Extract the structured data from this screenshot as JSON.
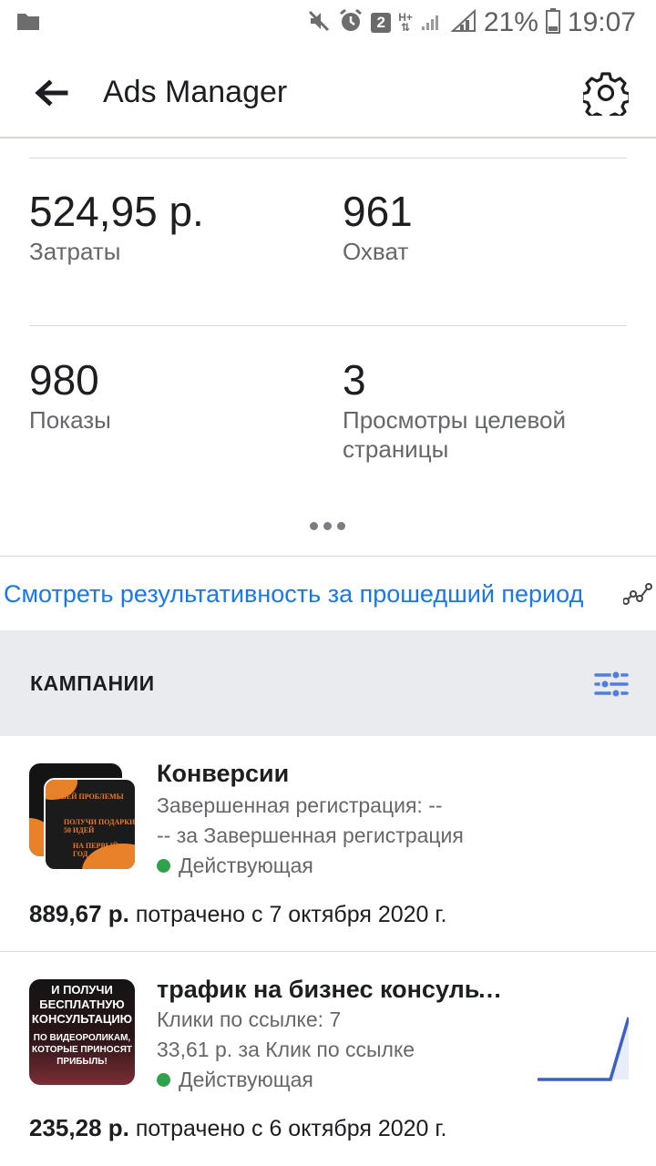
{
  "status_bar": {
    "battery": "21%",
    "time": "19:07",
    "sim_badge": "2",
    "network": "H+"
  },
  "app_bar": {
    "title": "Ads Manager"
  },
  "metrics": [
    {
      "value": "524,95 р.",
      "label": "Затраты"
    },
    {
      "value": "961",
      "label": "Охват"
    },
    {
      "value": "980",
      "label": "Показы"
    },
    {
      "value": "3",
      "label": "Просмотры целевой страницы"
    }
  ],
  "performance_link": "Смотреть результативность за прошедший период",
  "campaigns_section": {
    "title": "КАМПАНИИ"
  },
  "campaigns": [
    {
      "name": "Конверсии",
      "result_line": "Завершенная регистрация: --",
      "cost_line": "-- за Завершенная регистрация",
      "status": "Действующая",
      "spent_amount": "889,67 р.",
      "spent_text": "потрачено с 7 октября 2020 г.",
      "thumb_text": [
        "РАЗБЕЙ ПРОБЛЕМЫ",
        "ПОЛУЧИ ПОДАРКИ 50 ИДЕЙ",
        "НА ПЕРВЫЙ ГОД"
      ]
    },
    {
      "name": "трафик на бизнес консультацию",
      "result_line": "Клики по ссылке: 7",
      "cost_line": "33,61 р. за Клик по ссылке",
      "status": "Действующая",
      "spent_amount": "235,28 р.",
      "spent_text": "потрачено с 6 октября 2020 г.",
      "thumb_text_top": "И ПОЛУЧИ БЕСПЛАТНУЮ КОНСУЛЬТАЦИЮ",
      "thumb_text_bottom": "ПО ВИДЕОРОЛИКАМ, КОТОРЫЕ ПРИНОСЯТ ПРИБЫЛЬ!",
      "sparkline": [
        0,
        0,
        0,
        0,
        0,
        7
      ]
    }
  ],
  "colors": {
    "link_blue": "#1877f2",
    "status_green": "#31a24c",
    "section_gray": "#e9ebee",
    "sparkline_blue": "#3b5fc4"
  }
}
